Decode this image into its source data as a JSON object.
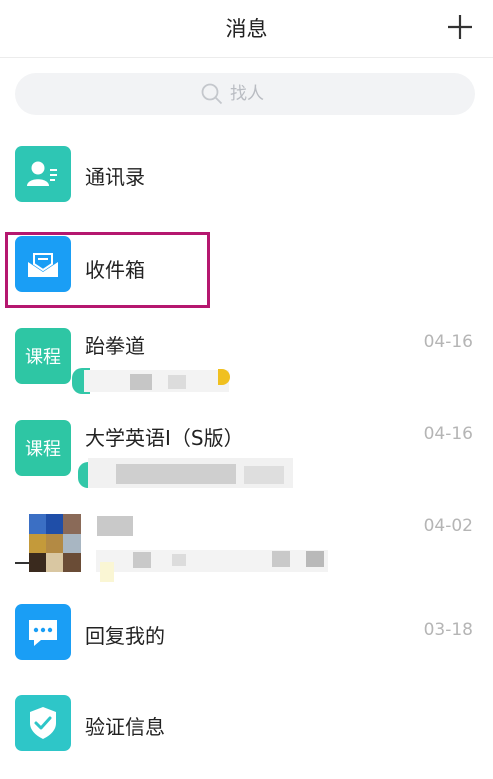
{
  "header": {
    "title": "消息",
    "add_icon": "plus-icon"
  },
  "search": {
    "placeholder": "找人",
    "icon": "search-icon"
  },
  "items": [
    {
      "title": "通讯录",
      "icon": "contacts-icon",
      "color": "#2ec6b4"
    },
    {
      "title": "收件箱",
      "icon": "inbox-icon",
      "color": "#1a9ef5"
    },
    {
      "title": "跆拳道",
      "badge": "课程",
      "date": "04-16",
      "color": "#2ec6a4"
    },
    {
      "title": "大学英语Ⅰ（S版）",
      "badge": "课程",
      "date": "04-16",
      "color": "#2ec6a4"
    },
    {
      "title": "",
      "date": "04-02"
    },
    {
      "title": "回复我的",
      "icon": "chat-icon",
      "date": "03-18",
      "color": "#1a9ef5"
    },
    {
      "title": "验证信息",
      "icon": "shield-check-icon",
      "color": "#2ec6c8"
    }
  ],
  "colors": {
    "accent_teal": "#2ec6b4",
    "accent_blue": "#1a9ef5",
    "highlight": "#b5176f"
  }
}
